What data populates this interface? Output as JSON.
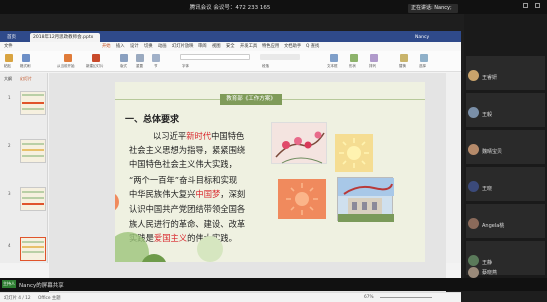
{
  "meeting": {
    "title": "腾讯会议 会议号：472 233 165",
    "speaking": "正在讲话: Nancy;"
  },
  "app": {
    "tabs": [
      "首页",
      "2018年12月思政教师会.pptx",
      "Nancy"
    ],
    "menus": [
      "文件",
      "开始",
      "插入",
      "设计",
      "切换",
      "动画",
      "幻灯片放映",
      "审阅",
      "视图",
      "安全",
      "开发工具",
      "特色应用",
      "文档助手",
      "Q 查找"
    ],
    "active_menu": "开始",
    "ribbon": [
      "粘贴",
      "格式刷",
      "从当前开始",
      "新建幻灯片",
      "版式",
      "重置",
      "节",
      "字体",
      "段落",
      "文本框",
      "形状",
      "排列",
      "替换",
      "选择"
    ]
  },
  "thumbs": {
    "tabs": [
      "大纲",
      "幻灯片"
    ],
    "numbers": [
      "1",
      "2",
      "3",
      "4"
    ]
  },
  "slide": {
    "header": "教育部《工作方案》",
    "section_title": "一、总体要求",
    "body": [
      {
        "pre": "以习近平",
        "red": "新时代",
        "post": "中国特色"
      },
      {
        "pre": "社会主义思想为指导，紧紧围绕",
        "red": "",
        "post": ""
      },
      {
        "pre": "中国特色社会主义伟大实践，",
        "red": "",
        "post": ""
      },
      {
        "pre": "“两个一百年”奋斗目标和实现",
        "red": "",
        "post": ""
      },
      {
        "pre": "中华民族伟大复兴",
        "red": "中国梦",
        "post": "，深刻"
      },
      {
        "pre": "认识中国共产党团结带领全国各",
        "red": "",
        "post": ""
      },
      {
        "pre": "族人民进行的革命、建设、改革",
        "red": "",
        "post": ""
      },
      {
        "pre": "实践是",
        "red": "爱国主义",
        "post": "的伟大实践。"
      }
    ]
  },
  "statusbar": {
    "slide_info": "幻灯片 4 / 12",
    "theme": "Office 主题",
    "zoom": "67%"
  },
  "share": {
    "badge": "主持人",
    "text": "Nancy的屏幕共享"
  },
  "participants": [
    {
      "name": "王睿妍",
      "color": "#c9a36b"
    },
    {
      "name": "王毅",
      "color": "#7a8fa8"
    },
    {
      "name": "魏晴宝贝",
      "color": "#b58a6a"
    },
    {
      "name": "王晓",
      "color": "#3b4a7a"
    },
    {
      "name": "Angela桃",
      "color": "#8a6a5a"
    },
    {
      "name": "王静",
      "color": "#5a7a5a"
    },
    {
      "name": "蔡晓燕",
      "color": "#9a8a7a"
    }
  ],
  "colors": {
    "accent": "#d9252b",
    "header_green": "#7f9b59",
    "slide_bg": "#eff1e1"
  }
}
